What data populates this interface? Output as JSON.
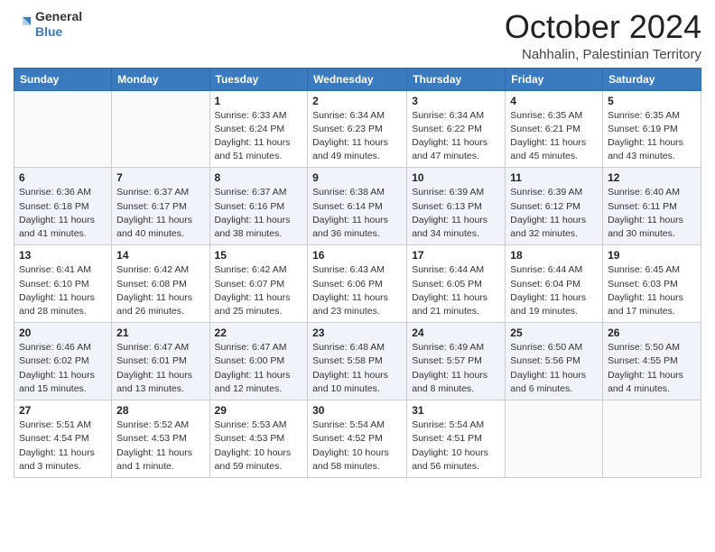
{
  "header": {
    "logo_general": "General",
    "logo_blue": "Blue",
    "month": "October 2024",
    "location": "Nahhalin, Palestinian Territory"
  },
  "weekdays": [
    "Sunday",
    "Monday",
    "Tuesday",
    "Wednesday",
    "Thursday",
    "Friday",
    "Saturday"
  ],
  "weeks": [
    [
      {
        "day": null
      },
      {
        "day": null
      },
      {
        "day": "1",
        "sunrise": "6:33 AM",
        "sunset": "6:24 PM",
        "daylight": "11 hours and 51 minutes."
      },
      {
        "day": "2",
        "sunrise": "6:34 AM",
        "sunset": "6:23 PM",
        "daylight": "11 hours and 49 minutes."
      },
      {
        "day": "3",
        "sunrise": "6:34 AM",
        "sunset": "6:22 PM",
        "daylight": "11 hours and 47 minutes."
      },
      {
        "day": "4",
        "sunrise": "6:35 AM",
        "sunset": "6:21 PM",
        "daylight": "11 hours and 45 minutes."
      },
      {
        "day": "5",
        "sunrise": "6:35 AM",
        "sunset": "6:19 PM",
        "daylight": "11 hours and 43 minutes."
      }
    ],
    [
      {
        "day": "6",
        "sunrise": "6:36 AM",
        "sunset": "6:18 PM",
        "daylight": "11 hours and 41 minutes."
      },
      {
        "day": "7",
        "sunrise": "6:37 AM",
        "sunset": "6:17 PM",
        "daylight": "11 hours and 40 minutes."
      },
      {
        "day": "8",
        "sunrise": "6:37 AM",
        "sunset": "6:16 PM",
        "daylight": "11 hours and 38 minutes."
      },
      {
        "day": "9",
        "sunrise": "6:38 AM",
        "sunset": "6:14 PM",
        "daylight": "11 hours and 36 minutes."
      },
      {
        "day": "10",
        "sunrise": "6:39 AM",
        "sunset": "6:13 PM",
        "daylight": "11 hours and 34 minutes."
      },
      {
        "day": "11",
        "sunrise": "6:39 AM",
        "sunset": "6:12 PM",
        "daylight": "11 hours and 32 minutes."
      },
      {
        "day": "12",
        "sunrise": "6:40 AM",
        "sunset": "6:11 PM",
        "daylight": "11 hours and 30 minutes."
      }
    ],
    [
      {
        "day": "13",
        "sunrise": "6:41 AM",
        "sunset": "6:10 PM",
        "daylight": "11 hours and 28 minutes."
      },
      {
        "day": "14",
        "sunrise": "6:42 AM",
        "sunset": "6:08 PM",
        "daylight": "11 hours and 26 minutes."
      },
      {
        "day": "15",
        "sunrise": "6:42 AM",
        "sunset": "6:07 PM",
        "daylight": "11 hours and 25 minutes."
      },
      {
        "day": "16",
        "sunrise": "6:43 AM",
        "sunset": "6:06 PM",
        "daylight": "11 hours and 23 minutes."
      },
      {
        "day": "17",
        "sunrise": "6:44 AM",
        "sunset": "6:05 PM",
        "daylight": "11 hours and 21 minutes."
      },
      {
        "day": "18",
        "sunrise": "6:44 AM",
        "sunset": "6:04 PM",
        "daylight": "11 hours and 19 minutes."
      },
      {
        "day": "19",
        "sunrise": "6:45 AM",
        "sunset": "6:03 PM",
        "daylight": "11 hours and 17 minutes."
      }
    ],
    [
      {
        "day": "20",
        "sunrise": "6:46 AM",
        "sunset": "6:02 PM",
        "daylight": "11 hours and 15 minutes."
      },
      {
        "day": "21",
        "sunrise": "6:47 AM",
        "sunset": "6:01 PM",
        "daylight": "11 hours and 13 minutes."
      },
      {
        "day": "22",
        "sunrise": "6:47 AM",
        "sunset": "6:00 PM",
        "daylight": "11 hours and 12 minutes."
      },
      {
        "day": "23",
        "sunrise": "6:48 AM",
        "sunset": "5:58 PM",
        "daylight": "11 hours and 10 minutes."
      },
      {
        "day": "24",
        "sunrise": "6:49 AM",
        "sunset": "5:57 PM",
        "daylight": "11 hours and 8 minutes."
      },
      {
        "day": "25",
        "sunrise": "6:50 AM",
        "sunset": "5:56 PM",
        "daylight": "11 hours and 6 minutes."
      },
      {
        "day": "26",
        "sunrise": "5:50 AM",
        "sunset": "4:55 PM",
        "daylight": "11 hours and 4 minutes."
      }
    ],
    [
      {
        "day": "27",
        "sunrise": "5:51 AM",
        "sunset": "4:54 PM",
        "daylight": "11 hours and 3 minutes."
      },
      {
        "day": "28",
        "sunrise": "5:52 AM",
        "sunset": "4:53 PM",
        "daylight": "11 hours and 1 minute."
      },
      {
        "day": "29",
        "sunrise": "5:53 AM",
        "sunset": "4:53 PM",
        "daylight": "10 hours and 59 minutes."
      },
      {
        "day": "30",
        "sunrise": "5:54 AM",
        "sunset": "4:52 PM",
        "daylight": "10 hours and 58 minutes."
      },
      {
        "day": "31",
        "sunrise": "5:54 AM",
        "sunset": "4:51 PM",
        "daylight": "10 hours and 56 minutes."
      },
      {
        "day": null
      },
      {
        "day": null
      }
    ]
  ],
  "labels": {
    "sunrise_prefix": "Sunrise: ",
    "sunset_prefix": "Sunset: ",
    "daylight_prefix": "Daylight: "
  }
}
